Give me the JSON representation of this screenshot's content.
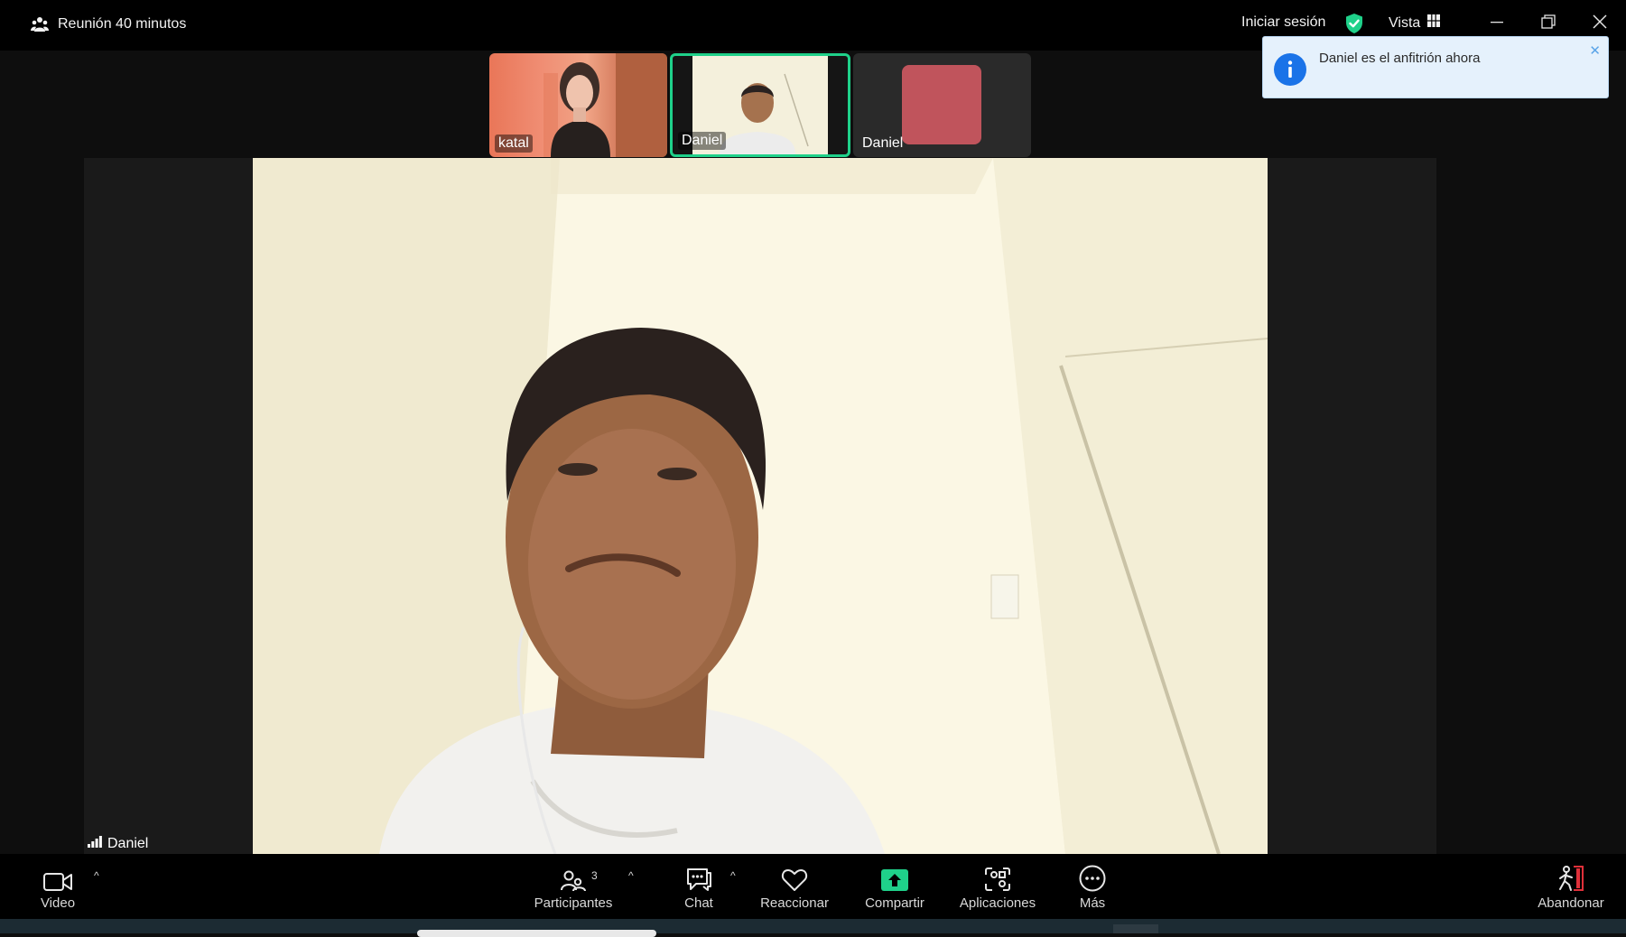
{
  "window": {
    "title": "Reunión 40 minutos",
    "signin_label": "Iniciar sesión",
    "view_label": "Vista"
  },
  "notification": {
    "text": "Daniel es el anfitrión ahora",
    "close_glyph": "✕"
  },
  "thumbnails": [
    {
      "name": "katal",
      "type": "video"
    },
    {
      "name": "Daniel",
      "type": "video",
      "active_speaker": true
    },
    {
      "name": "Daniel",
      "type": "avatar",
      "avatar_color": "#c0545c"
    }
  ],
  "main_video": {
    "speaker_name": "Daniel"
  },
  "toolbar": {
    "video_label": "Video",
    "participants_label": "Participantes",
    "participants_count": "3",
    "chat_label": "Chat",
    "react_label": "Reaccionar",
    "share_label": "Compartir",
    "apps_label": "Aplicaciones",
    "more_label": "Más",
    "leave_label": "Abandonar",
    "caret_glyph": "^"
  },
  "colors": {
    "active_border": "#1fd18a",
    "share_green": "#1fd18a",
    "leave_red": "#e0303a",
    "notification_bg": "#e5f1fc",
    "info_blue": "#1a73e8"
  }
}
